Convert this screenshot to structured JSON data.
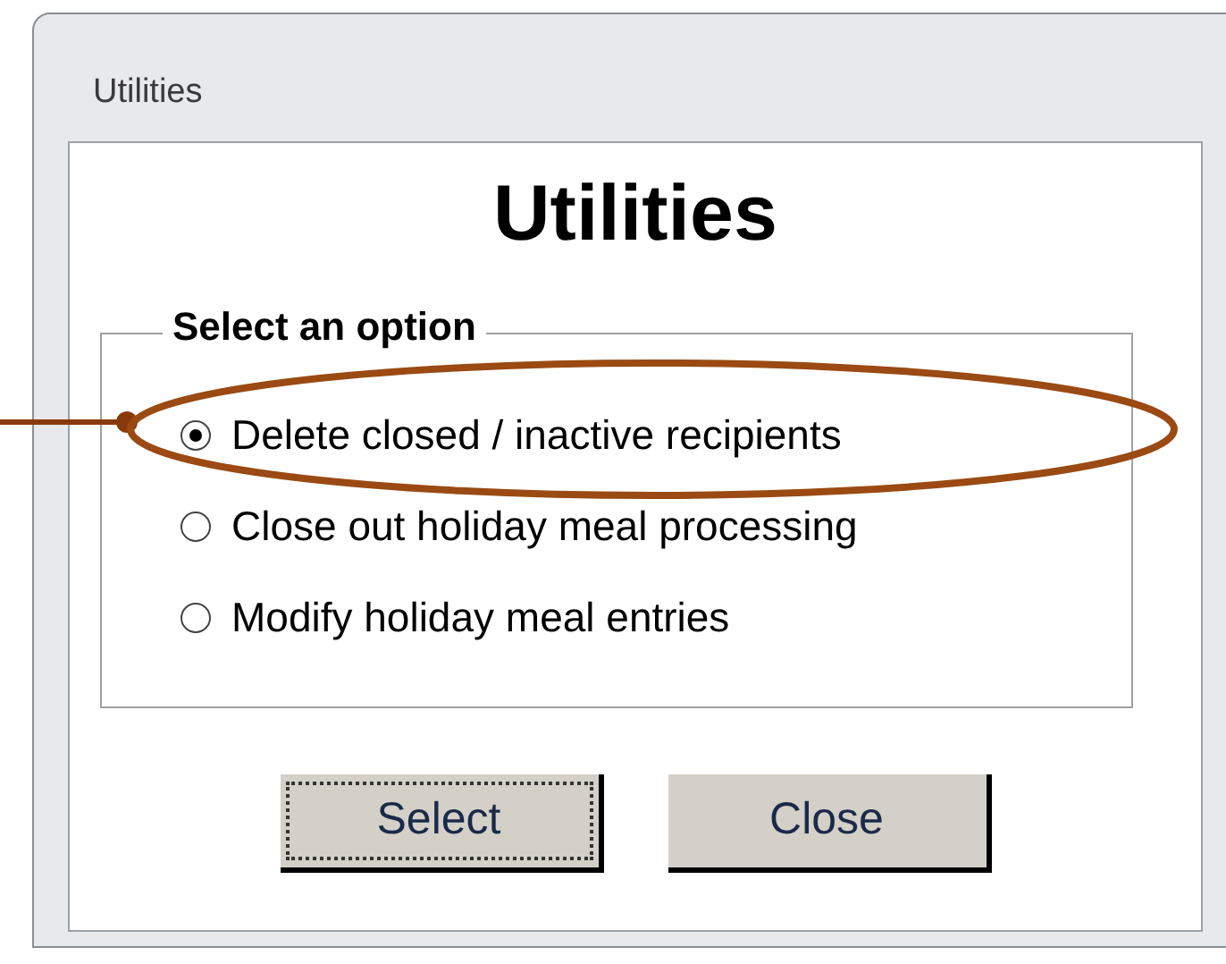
{
  "window": {
    "title": "Utilities"
  },
  "heading": "Utilities",
  "group": {
    "legend": "Select an option",
    "options": [
      {
        "label": "Delete closed / inactive recipients",
        "selected": true
      },
      {
        "label": "Close out holiday meal processing",
        "selected": false
      },
      {
        "label": "Modify holiday meal entries",
        "selected": false
      }
    ]
  },
  "buttons": [
    {
      "label": "Select",
      "focused": true
    },
    {
      "label": "Close",
      "focused": false
    }
  ]
}
